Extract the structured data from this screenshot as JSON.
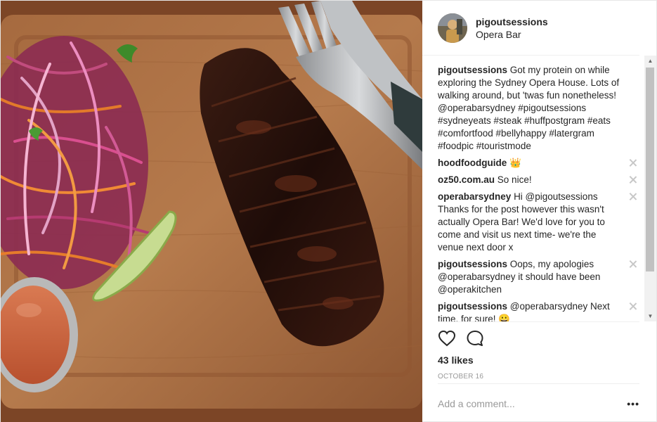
{
  "post": {
    "username": "pigoutsessions",
    "location": "Opera Bar",
    "likes": "43 likes",
    "date": "October 16",
    "add_comment_placeholder": "Add a comment...",
    "more_label": "•••"
  },
  "comments": [
    {
      "user": "pigoutsessions",
      "text": "Got my protein on while exploring the Sydney Opera House. Lots of walking around, but 'twas fun nonetheless! @operabarsydney #pigoutsessions #sydneyeats #steak #huffpostgram #eats #comfortfood #bellyhappy #latergram #foodpic #touristmode",
      "deletable": false
    },
    {
      "user": "hoodfoodguide",
      "text": "👑",
      "deletable": true
    },
    {
      "user": "oz50.com.au",
      "text": "So nice!",
      "deletable": true
    },
    {
      "user": "operabarsydney",
      "text": "Hi @pigoutsessions Thanks for the post however this wasn't actually Opera Bar! We'd love for you to come and visit us next time- we're the venue next door x",
      "deletable": true
    },
    {
      "user": "pigoutsessions",
      "text": "Oops, my apologies @operabarsydney it should have been @operakitchen",
      "deletable": true
    },
    {
      "user": "pigoutsessions",
      "text": "@operabarsydney Next time, for sure! 😀",
      "deletable": true
    }
  ],
  "icons": {
    "like": "heart-icon",
    "comment": "comment-icon",
    "close": "close-icon"
  },
  "colors": {
    "text": "#262626",
    "muted": "#999999",
    "border": "#efefef",
    "link": "#003569"
  }
}
